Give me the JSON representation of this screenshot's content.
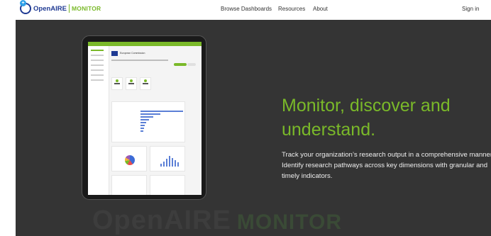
{
  "header": {
    "logo": {
      "brand": "OpenAIRE",
      "product": "MONITOR"
    },
    "nav": [
      {
        "label": "Browse Dashboards"
      },
      {
        "label": "Resources"
      },
      {
        "label": "About"
      }
    ],
    "signin_label": "Sign in"
  },
  "hero": {
    "headline": "Monitor, discover and understand.",
    "description": "Track your organization’s research output in a comprehensive manner. Identify research pathways across key dimensions with granular and timely indicators.",
    "background_watermark": {
      "brand": "OpenAIRE",
      "product": "MONITOR"
    },
    "tablet_preview": {
      "organization": "European Commission"
    }
  },
  "colors": {
    "accent": "#7ab929",
    "brand_blue": "#1f3a93",
    "hero_bg": "#343434"
  }
}
